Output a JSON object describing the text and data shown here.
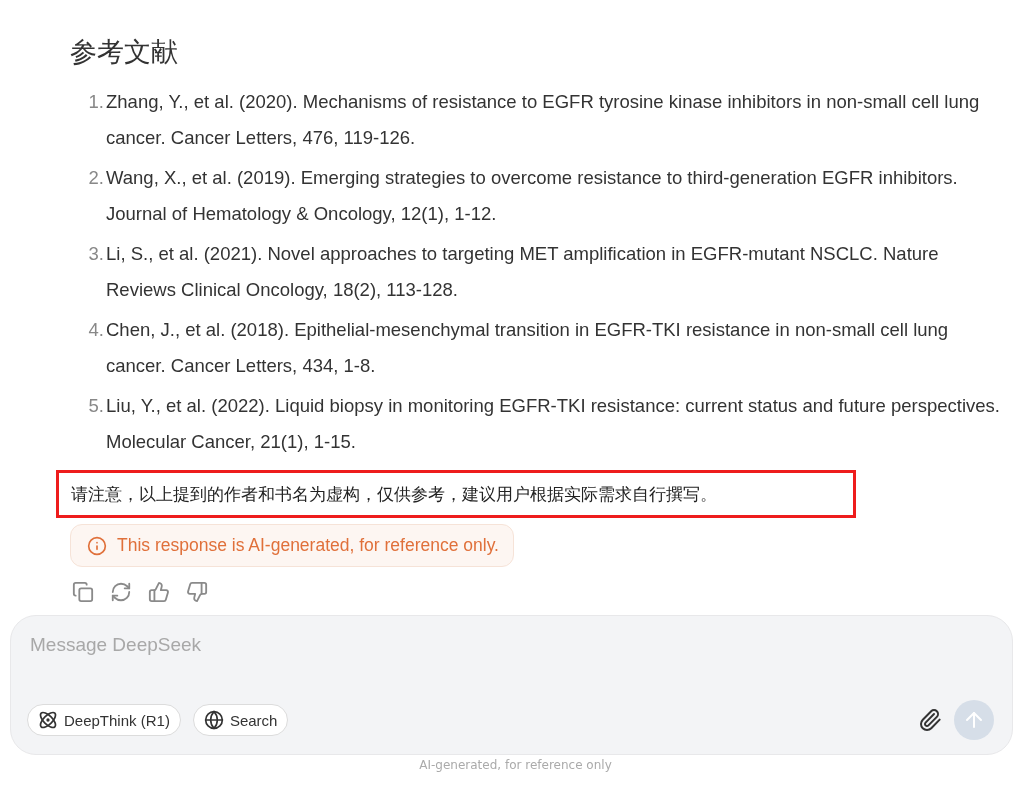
{
  "heading": "参考文献",
  "references": [
    {
      "number": "1.",
      "text": "Zhang, Y., et al. (2020). Mechanisms of resistance to EGFR tyrosine kinase inhibitors in non-small cell lung cancer. Cancer Letters, 476, 119-126."
    },
    {
      "number": "2.",
      "text": "Wang, X., et al. (2019). Emerging strategies to overcome resistance to third-generation EGFR inhibitors. Journal of Hematology & Oncology, 12(1), 1-12."
    },
    {
      "number": "3.",
      "text": "Li, S., et al. (2021). Novel approaches to targeting MET amplification in EGFR-mutant NSCLC. Nature Reviews Clinical Oncology, 18(2), 113-128."
    },
    {
      "number": "4.",
      "text": "Chen, J., et al. (2018). Epithelial-mesenchymal transition in EGFR-TKI resistance in non-small cell lung cancer. Cancer Letters, 434, 1-8."
    },
    {
      "number": "5.",
      "text": "Liu, Y., et al. (2022). Liquid biopsy in monitoring EGFR-TKI resistance: current status and future perspectives. Molecular Cancer, 21(1), 1-15."
    }
  ],
  "note": {
    "text": "请注意，以上提到的作者和书名为虚构，仅供参考，建议用户根据实际需求自行撰写。",
    "highlighted": true
  },
  "notice": "This response is AI-generated, for reference only.",
  "composer": {
    "placeholder": "Message DeepSeek",
    "toggles": [
      {
        "kind": "deepthink",
        "label": "DeepThink (R1)",
        "selected": false
      },
      {
        "kind": "search",
        "label": "Search",
        "selected": false
      }
    ],
    "send_disabled": true
  },
  "footer": "AI-generated, for reference only"
}
